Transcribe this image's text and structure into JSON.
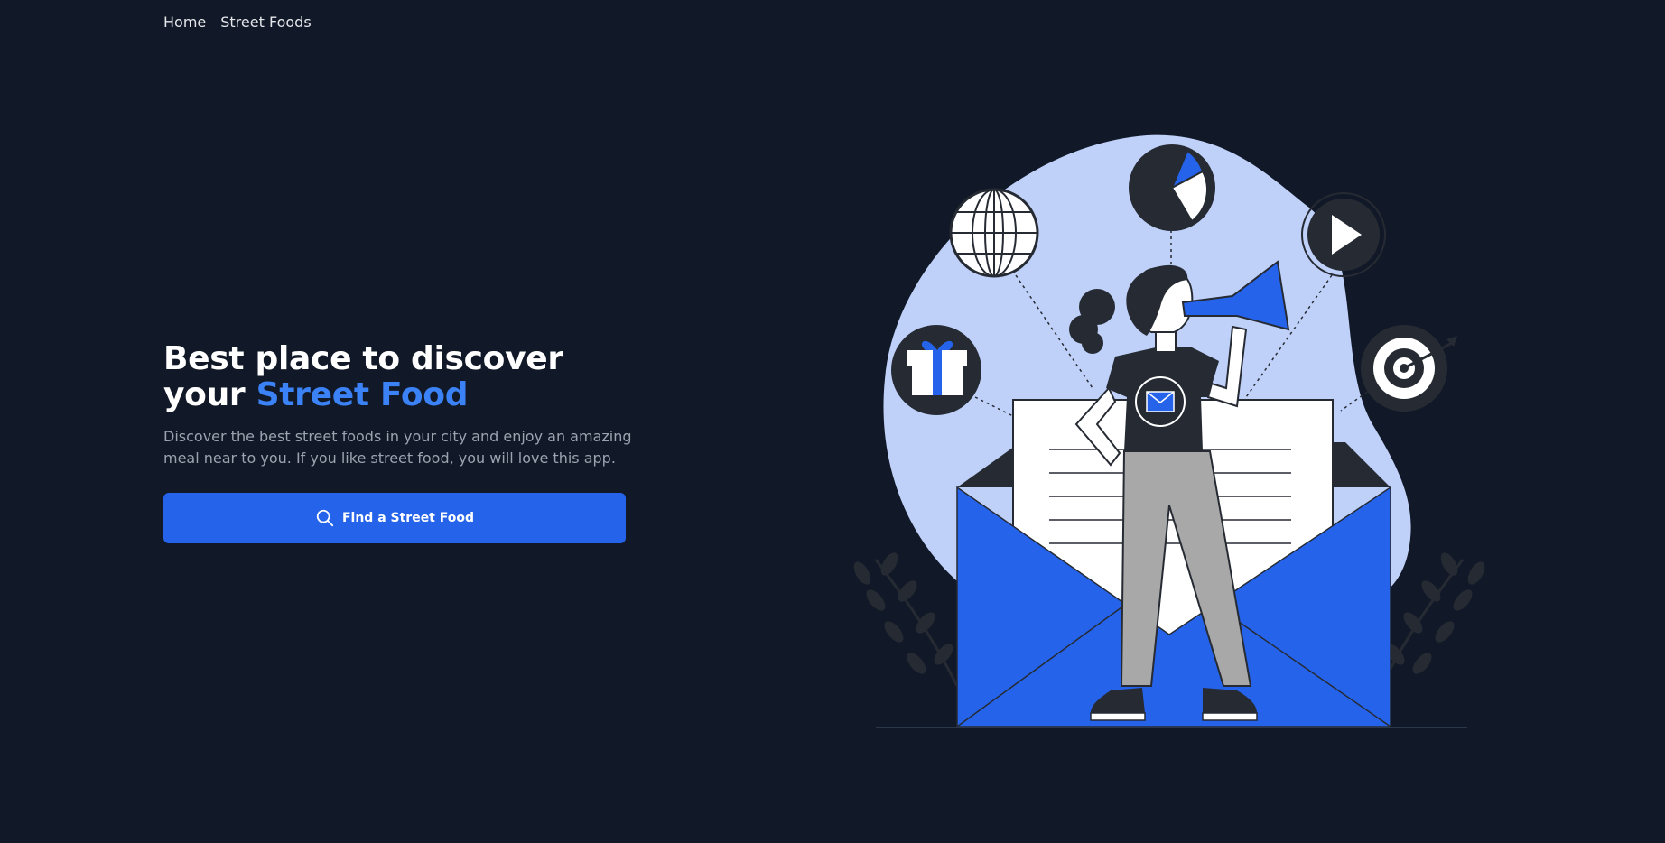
{
  "nav": {
    "items": [
      {
        "label": "Home"
      },
      {
        "label": "Street Foods"
      }
    ]
  },
  "hero": {
    "headline_line1": "Best place to discover",
    "headline_line2_prefix": "your ",
    "headline_accent": "Street Food",
    "description": "Discover the best street foods in your city and enjoy an amazing meal near to you. If you like street food, you will love this app.",
    "cta_label": "Find a Street Food",
    "cta_icon": "search-icon"
  },
  "colors": {
    "background": "#111827",
    "accent": "#3b82f6",
    "button": "#2563eb",
    "blob": "#bfd0f9",
    "dark": "#262b33"
  }
}
